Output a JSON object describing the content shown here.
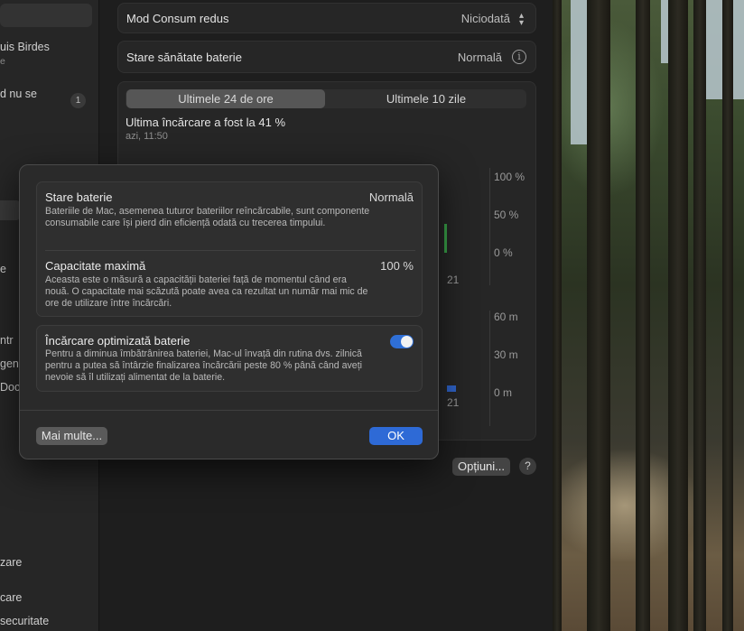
{
  "sidebar": {
    "items": [
      {
        "label": "uis Birdes"
      },
      {
        "label": "e"
      },
      {
        "label": "d nu se"
      },
      {
        "label": "1"
      },
      {
        "label": "e"
      },
      {
        "label": "ntr"
      },
      {
        "label": "gen"
      },
      {
        "label": "Doc"
      },
      {
        "label": "zare"
      },
      {
        "label": "care"
      },
      {
        "label": "securitate"
      }
    ]
  },
  "main": {
    "low_power": {
      "label": "Mod Consum redus",
      "value": "Niciodată"
    },
    "battery_health": {
      "label": "Stare sănătate baterie",
      "value": "Normală"
    },
    "tabs": [
      {
        "label": "Ultimele 24 de ore",
        "active": true
      },
      {
        "label": "Ultimele 10 zile",
        "active": false
      }
    ],
    "last_charge": {
      "title": "Ultima încărcare a fost la 41 %",
      "time": "azi, 11:50"
    },
    "chart_level": {
      "ticks": [
        "100 %",
        "50 %",
        "0 %"
      ],
      "x_label": "21"
    },
    "chart_usage": {
      "ticks": [
        "60 m",
        "30 m",
        "0 m"
      ],
      "x_label": "21"
    },
    "options_button": "Opțiuni...",
    "help": "?"
  },
  "modal": {
    "battery_state": {
      "title": "Stare baterie",
      "value": "Normală",
      "description": "Bateriile de Mac, asemenea tuturor bateriilor reîncărcabile, sunt componente consumabile care își pierd din eficiență odată cu trecerea timpului."
    },
    "max_capacity": {
      "title": "Capacitate maximă",
      "value": "100 %",
      "description": "Aceasta este o măsură a capacității bateriei față de momentul când era nouă. O capacitate mai scăzută poate avea ca rezultat un număr mai mic de ore de utilizare între încărcări."
    },
    "optimized_charging": {
      "title": "Încărcare optimizată baterie",
      "enabled": true,
      "description": "Pentru a diminua îmbătrânirea bateriei, Mac-ul învață din rutina dvs. zilnică pentru a putea să întârzie finalizarea încărcării peste 80 % până când aveți nevoie să îl utilizați alimentat de la baterie."
    },
    "more_button": "Mai multe...",
    "ok_button": "OK"
  },
  "colors": {
    "accent": "#2e6ad6",
    "level_bar": "#3aa34a",
    "usage_bar": "#2f63c9"
  }
}
